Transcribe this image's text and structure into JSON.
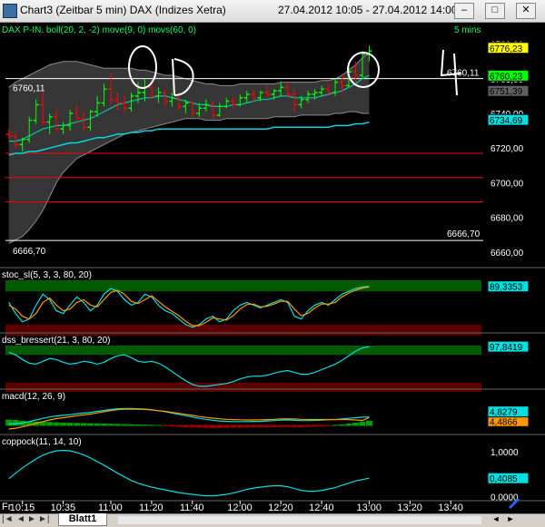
{
  "window": {
    "title": "Chart3 (Zeitbar 5 min)  DAX (Indizes Xetra)",
    "range": "27.04.2012 10:05 - 27.04.2012 14:00",
    "min_label": "–",
    "max_label": "□",
    "close_label": "✕"
  },
  "tabs": {
    "sheet": "Blatt1",
    "first": "|◄",
    "prev": "◄",
    "next": "►",
    "last": "►|",
    "left": "◄",
    "right": "►"
  },
  "colors": {
    "bg": "#000000",
    "band": "#404040",
    "bb_line": "#8a8a8a",
    "ma_fast": "#00c8a0",
    "ma_slow": "#00d8e8",
    "bull": "#00ff00",
    "bear": "#ff0000",
    "level": "#ff0000",
    "label_bg": "#ffff00"
  },
  "chart_data": [
    {
      "type": "candlestick",
      "title": "DAX P-IN.  boll(20, 2, -2)  move(9, 0)  movs(60, 0)",
      "interval_label": "5 mins",
      "ylim": [
        6650,
        6785
      ],
      "yticks": [
        "6660,00",
        "6680,00",
        "6700,00",
        "6720,00",
        "6740,00",
        "6760,00",
        "6780,00"
      ],
      "horizontal_lines": [
        {
          "value": 6760.11,
          "label": "6760,11",
          "color": "#ffffff"
        },
        {
          "value": 6666.7,
          "label": "6666,70",
          "color": "#ffffff"
        },
        {
          "value": 6717,
          "color": "#ff0000"
        },
        {
          "value": 6703,
          "color": "#ff0000"
        },
        {
          "value": 6689,
          "color": "#ff0000"
        }
      ],
      "right_labels": [
        {
          "value": 6776.23,
          "text": "6776,23",
          "bg": "#ffff00",
          "fg": "#000000"
        },
        {
          "value": 6760.23,
          "text": "6760,23",
          "bg": "#00ff00",
          "fg": "#000000"
        },
        {
          "value": 6751.39,
          "text": "6751,39",
          "bg": "#606060",
          "fg": "#000000"
        },
        {
          "value": 6734.69,
          "text": "6734,69",
          "bg": "#00e0e0",
          "fg": "#000000"
        }
      ],
      "candles": [
        [
          6728,
          6731,
          6725,
          6727
        ],
        [
          6727,
          6729,
          6720,
          6722
        ],
        [
          6722,
          6726,
          6718,
          6725
        ],
        [
          6725,
          6738,
          6723,
          6736
        ],
        [
          6736,
          6748,
          6734,
          6745
        ],
        [
          6745,
          6752,
          6733,
          6735
        ],
        [
          6735,
          6740,
          6728,
          6738
        ],
        [
          6738,
          6742,
          6729,
          6731
        ],
        [
          6731,
          6735,
          6728,
          6733
        ],
        [
          6733,
          6742,
          6730,
          6740
        ],
        [
          6740,
          6745,
          6735,
          6737
        ],
        [
          6737,
          6741,
          6730,
          6732
        ],
        [
          6732,
          6742,
          6730,
          6741
        ],
        [
          6741,
          6750,
          6738,
          6746
        ],
        [
          6746,
          6757,
          6744,
          6754
        ],
        [
          6754,
          6763,
          6745,
          6748
        ],
        [
          6748,
          6752,
          6742,
          6746
        ],
        [
          6746,
          6750,
          6740,
          6743
        ],
        [
          6743,
          6752,
          6741,
          6750
        ],
        [
          6750,
          6758,
          6746,
          6752
        ],
        [
          6752,
          6760,
          6747,
          6755
        ],
        [
          6755,
          6758,
          6748,
          6750
        ],
        [
          6750,
          6755,
          6746,
          6752
        ],
        [
          6752,
          6754,
          6744,
          6747
        ],
        [
          6747,
          6752,
          6744,
          6749
        ],
        [
          6749,
          6752,
          6742,
          6744
        ],
        [
          6744,
          6748,
          6740,
          6746
        ],
        [
          6746,
          6747,
          6738,
          6740
        ],
        [
          6740,
          6746,
          6738,
          6743
        ],
        [
          6743,
          6748,
          6741,
          6745
        ],
        [
          6745,
          6747,
          6737,
          6739
        ],
        [
          6739,
          6746,
          6738,
          6744
        ],
        [
          6744,
          6749,
          6743,
          6747
        ],
        [
          6747,
          6750,
          6743,
          6745
        ],
        [
          6745,
          6751,
          6744,
          6749
        ],
        [
          6749,
          6753,
          6746,
          6751
        ],
        [
          6751,
          6754,
          6747,
          6749
        ],
        [
          6749,
          6753,
          6747,
          6752
        ],
        [
          6752,
          6756,
          6749,
          6751
        ],
        [
          6751,
          6754,
          6748,
          6753
        ],
        [
          6753,
          6758,
          6750,
          6755
        ],
        [
          6755,
          6758,
          6749,
          6751
        ],
        [
          6751,
          6754,
          6740,
          6745
        ],
        [
          6745,
          6750,
          6743,
          6748
        ],
        [
          6748,
          6753,
          6746,
          6751
        ],
        [
          6751,
          6754,
          6748,
          6752
        ],
        [
          6752,
          6756,
          6750,
          6754
        ],
        [
          6754,
          6757,
          6750,
          6752
        ],
        [
          6752,
          6760,
          6750,
          6758
        ],
        [
          6758,
          6763,
          6752,
          6756
        ],
        [
          6756,
          6768,
          6755,
          6764
        ],
        [
          6764,
          6770,
          6758,
          6762
        ],
        [
          6762,
          6776,
          6760,
          6774
        ],
        [
          6774,
          6779,
          6770,
          6776
        ]
      ],
      "boll_upper": [
        6755,
        6758,
        6760,
        6762,
        6764,
        6766,
        6768,
        6769,
        6770,
        6770,
        6770,
        6769,
        6768,
        6767,
        6766,
        6766,
        6766,
        6766,
        6766,
        6765,
        6765,
        6764,
        6763,
        6762,
        6762,
        6761,
        6760,
        6759,
        6758,
        6757,
        6757,
        6756,
        6756,
        6756,
        6757,
        6757,
        6757,
        6757,
        6757,
        6757,
        6758,
        6758,
        6758,
        6758,
        6758,
        6758,
        6759,
        6759,
        6760,
        6762,
        6765,
        6768,
        6772,
        6775
      ],
      "boll_lower": [
        6665,
        6667,
        6669,
        6673,
        6678,
        6684,
        6692,
        6700,
        6706,
        6710,
        6714,
        6716,
        6718,
        6720,
        6722,
        6724,
        6726,
        6728,
        6729,
        6730,
        6731,
        6732,
        6733,
        6734,
        6735,
        6736,
        6737,
        6737,
        6737,
        6736,
        6736,
        6736,
        6737,
        6737,
        6737,
        6737,
        6737,
        6737,
        6737,
        6738,
        6738,
        6738,
        6738,
        6739,
        6739,
        6739,
        6739,
        6739,
        6740,
        6740,
        6741,
        6741,
        6740,
        6740
      ],
      "ma_fast": [
        6724,
        6724,
        6725,
        6727,
        6729,
        6731,
        6732,
        6733,
        6733,
        6734,
        6735,
        6736,
        6737,
        6739,
        6741,
        6743,
        6745,
        6746,
        6747,
        6748,
        6749,
        6749,
        6750,
        6750,
        6749,
        6748,
        6747,
        6746,
        6745,
        6745,
        6744,
        6744,
        6744,
        6745,
        6745,
        6746,
        6747,
        6748,
        6748,
        6749,
        6750,
        6750,
        6749,
        6749,
        6749,
        6749,
        6750,
        6751,
        6752,
        6753,
        6755,
        6757,
        6760,
        6762
      ],
      "ma_slow": [
        6716,
        6717,
        6717,
        6718,
        6718,
        6719,
        6720,
        6721,
        6722,
        6723,
        6723,
        6724,
        6725,
        6726,
        6726,
        6727,
        6728,
        6728,
        6729,
        6729,
        6730,
        6730,
        6731,
        6731,
        6731,
        6731,
        6731,
        6731,
        6731,
        6731,
        6731,
        6731,
        6731,
        6731,
        6731,
        6731,
        6731,
        6731,
        6731,
        6732,
        6732,
        6732,
        6732,
        6732,
        6732,
        6732,
        6732,
        6732,
        6733,
        6733,
        6733,
        6734,
        6734,
        6735
      ]
    },
    {
      "type": "line",
      "title": "stoc_sl(5, 3, 3, 80, 20)",
      "ylim": [
        0,
        100
      ],
      "value_label": "89,3353",
      "series": [
        {
          "name": "",
          "color": "#00e0e0",
          "values": [
            60,
            40,
            25,
            30,
            55,
            75,
            65,
            45,
            40,
            55,
            70,
            60,
            45,
            55,
            75,
            85,
            80,
            65,
            55,
            60,
            75,
            70,
            55,
            45,
            40,
            30,
            20,
            15,
            20,
            30,
            35,
            25,
            30,
            45,
            55,
            60,
            55,
            50,
            55,
            60,
            65,
            60,
            35,
            30,
            45,
            55,
            60,
            55,
            65,
            75,
            80,
            85,
            88,
            89
          ]
        },
        {
          "name": "",
          "color": "#ff9900",
          "values": [
            55,
            48,
            35,
            30,
            40,
            60,
            68,
            55,
            45,
            48,
            60,
            65,
            55,
            52,
            65,
            78,
            82,
            75,
            62,
            58,
            65,
            72,
            62,
            52,
            44,
            36,
            26,
            18,
            18,
            24,
            32,
            30,
            28,
            36,
            48,
            56,
            57,
            52,
            53,
            57,
            62,
            62,
            48,
            36,
            40,
            50,
            57,
            57,
            60,
            70,
            77,
            82,
            86,
            88
          ]
        }
      ]
    },
    {
      "type": "line",
      "title": "dss_bressert(21, 3, 80, 20)",
      "ylim": [
        0,
        100
      ],
      "value_label": "97,8419",
      "series": [
        {
          "name": "",
          "color": "#00e0e0",
          "values": [
            85,
            80,
            70,
            62,
            60,
            66,
            72,
            70,
            64,
            60,
            62,
            66,
            64,
            60,
            64,
            72,
            78,
            80,
            74,
            66,
            64,
            66,
            62,
            54,
            44,
            34,
            24,
            16,
            12,
            12,
            14,
            16,
            18,
            22,
            28,
            32,
            34,
            34,
            36,
            40,
            44,
            46,
            42,
            38,
            38,
            42,
            48,
            54,
            60,
            68,
            78,
            88,
            95,
            97.8
          ]
        }
      ]
    },
    {
      "type": "bar",
      "title": "macd(12, 26, 9)",
      "ylim": [
        -8,
        14
      ],
      "value_labels": [
        {
          "text": "4,4866",
          "bg": "#ff9900"
        },
        {
          "text": "4,8279",
          "bg": "#00e0e0"
        }
      ],
      "histogram": [
        3.2,
        3.0,
        2.6,
        2.2,
        2.0,
        2.0,
        1.8,
        1.6,
        1.4,
        1.3,
        1.2,
        1.1,
        1.0,
        0.9,
        0.8,
        0.7,
        0.6,
        0.5,
        0.4,
        0.3,
        0.2,
        0.1,
        0.0,
        -0.2,
        -0.4,
        -0.6,
        -0.8,
        -1.0,
        -1.1,
        -1.2,
        -1.3,
        -1.3,
        -1.2,
        -1.2,
        -1.1,
        -1.0,
        -0.9,
        -0.9,
        -0.8,
        -0.8,
        -0.7,
        -0.7,
        -0.8,
        -0.8,
        -0.7,
        -0.6,
        -0.4,
        -0.2,
        0.0,
        0.3,
        0.8,
        1.4,
        2.0,
        2.6
      ],
      "series": [
        {
          "name": "",
          "color": "#00e0e0",
          "values": [
            0.5,
            0.8,
            1.2,
            2.0,
            3.0,
            4.0,
            4.8,
            5.4,
            5.8,
            6.2,
            6.8,
            7.2,
            7.6,
            8.2,
            8.8,
            9.4,
            9.8,
            10.0,
            10.0,
            9.8,
            9.6,
            9.2,
            8.6,
            8.0,
            7.2,
            6.4,
            5.6,
            4.8,
            4.0,
            3.4,
            2.8,
            2.4,
            2.2,
            2.0,
            2.0,
            2.0,
            2.1,
            2.2,
            2.4,
            2.6,
            2.9,
            3.0,
            2.8,
            2.6,
            2.6,
            2.7,
            2.9,
            3.1,
            3.3,
            3.6,
            4.0,
            4.4,
            4.7,
            4.83
          ]
        },
        {
          "name": "",
          "color": "#ff9900",
          "values": [
            -2.5,
            -2.0,
            -1.2,
            -0.2,
            1.0,
            2.0,
            3.0,
            3.8,
            4.4,
            4.9,
            5.6,
            6.1,
            6.6,
            7.3,
            8.0,
            8.7,
            9.2,
            9.5,
            9.6,
            9.5,
            9.4,
            9.1,
            8.6,
            8.2,
            7.6,
            7.0,
            6.4,
            5.8,
            5.1,
            4.6,
            4.1,
            3.7,
            3.4,
            3.2,
            3.1,
            3.0,
            3.0,
            3.1,
            3.2,
            3.4,
            3.6,
            3.7,
            3.6,
            3.4,
            3.3,
            3.3,
            3.3,
            3.3,
            3.3,
            3.3,
            3.2,
            3.0,
            2.7,
            4.49
          ]
        }
      ]
    },
    {
      "type": "line",
      "title": "coppock(11, 14, 10)",
      "ylim": [
        -0.05,
        1.1
      ],
      "yticks": [
        "0,0000",
        "1,0000"
      ],
      "value_label": "0,4085",
      "series": [
        {
          "name": "",
          "color": "#00e0e0",
          "values": [
            0.4,
            0.52,
            0.64,
            0.74,
            0.84,
            0.92,
            0.98,
            1.02,
            1.03,
            1.02,
            0.98,
            0.93,
            0.86,
            0.78,
            0.7,
            0.61,
            0.52,
            0.44,
            0.36,
            0.3,
            0.25,
            0.21,
            0.18,
            0.15,
            0.12,
            0.09,
            0.07,
            0.05,
            0.03,
            0.02,
            0.02,
            0.03,
            0.05,
            0.08,
            0.12,
            0.16,
            0.19,
            0.21,
            0.23,
            0.24,
            0.24,
            0.22,
            0.18,
            0.14,
            0.12,
            0.12,
            0.14,
            0.17,
            0.2,
            0.25,
            0.3,
            0.35,
            0.38,
            0.41
          ]
        }
      ]
    }
  ],
  "x_axis": {
    "ticks": [
      {
        "i": 2,
        "label": "10:15"
      },
      {
        "i": 8,
        "label": "10:35"
      },
      {
        "i": 15,
        "label": "11:00"
      },
      {
        "i": 21,
        "label": "11:20"
      },
      {
        "i": 27,
        "label": "11:40"
      },
      {
        "i": 34,
        "label": "12:00"
      },
      {
        "i": 40,
        "label": "12:20"
      },
      {
        "i": 46,
        "label": "12:40"
      },
      {
        "i": 53,
        "label": "13:00"
      },
      {
        "i": 59,
        "label": "13:20"
      },
      {
        "i": 65,
        "label": "13:40"
      }
    ],
    "day_label": "Fr",
    "span": 70
  }
}
